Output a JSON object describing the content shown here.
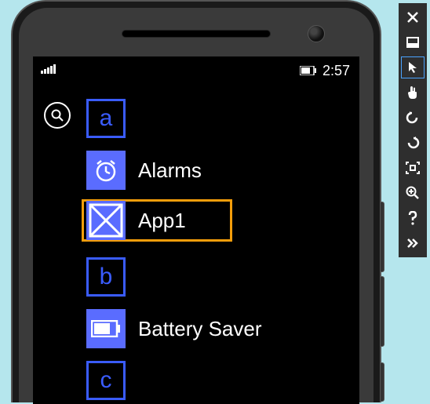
{
  "status": {
    "time": "2:57"
  },
  "apps": {
    "header_a": "a",
    "alarms": "Alarms",
    "app1": "App1",
    "header_b": "b",
    "battery_saver": "Battery Saver",
    "header_c": "c"
  },
  "toolbar": {
    "close": "Close",
    "minimize": "Minimize",
    "pointer": "Single-point input",
    "touch": "Touch input",
    "rotate_left": "Rotate left",
    "rotate_right": "Rotate right",
    "fit": "Fit to screen",
    "zoom": "Zoom",
    "help": "Help",
    "more": "More"
  }
}
